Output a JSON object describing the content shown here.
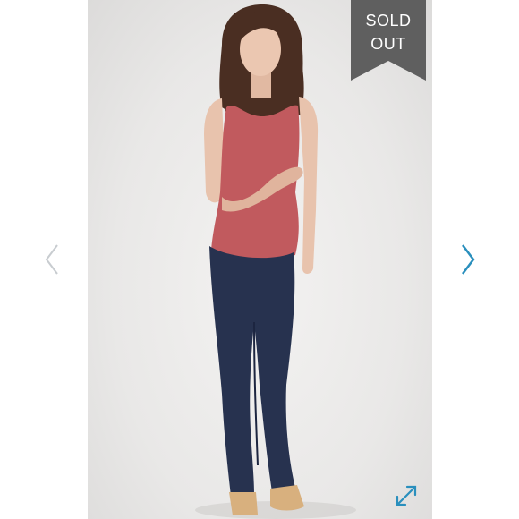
{
  "badge": {
    "line1": "SOLD",
    "line2": "OUT",
    "color": "#5f5f5f"
  },
  "navigation": {
    "prev_icon": "chevron-left-icon",
    "next_icon": "chevron-right-icon",
    "prev_color": "#c8ccd0",
    "next_color": "#2a8fbd"
  },
  "expand": {
    "icon": "expand-arrows-icon",
    "color": "#2a8fbd"
  },
  "colors": {
    "top": "#c15a5e",
    "jeans": "#27324f",
    "hair": "#4a2e22",
    "skin": "#e8c3ad"
  }
}
